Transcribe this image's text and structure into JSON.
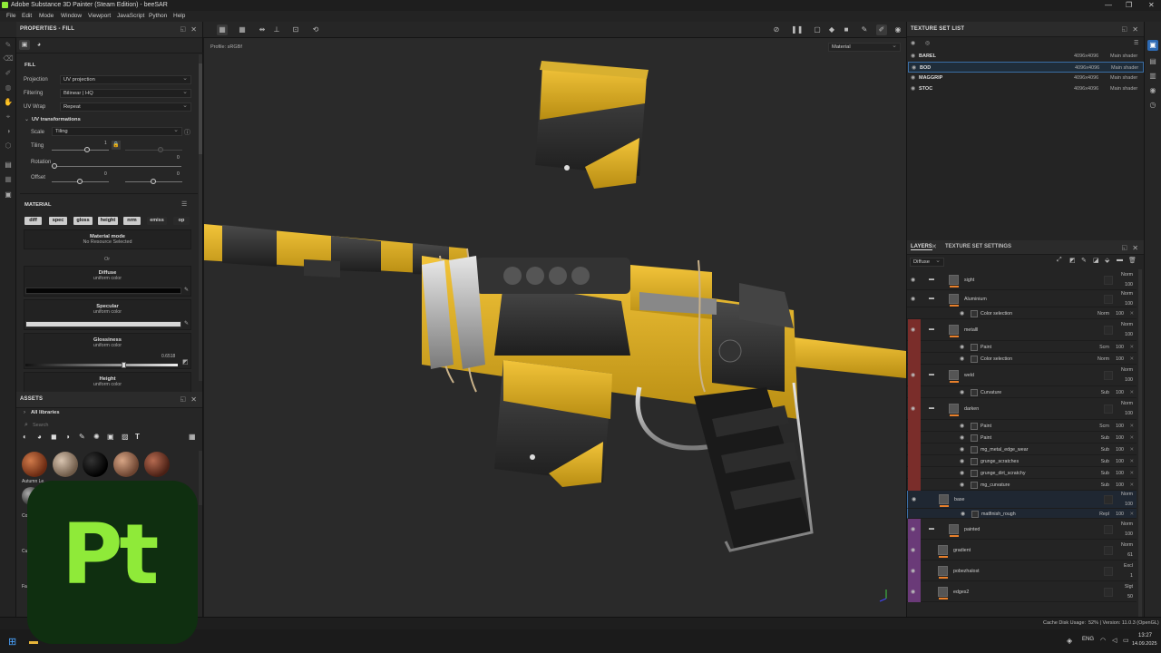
{
  "window": {
    "title": "Adobe Substance 3D Painter (Steam Edition) - beeSAR",
    "min": "—",
    "max": "❐",
    "close": "✕"
  },
  "menu": [
    "File",
    "Edit",
    "Mode",
    "Window",
    "Viewport",
    "JavaScript",
    "Python",
    "Help"
  ],
  "properties": {
    "title": "PROPERTIES - FILL",
    "section_fill": "FILL",
    "projection_label": "Projection",
    "projection_value": "UV projection",
    "filtering_label": "Filtering",
    "filtering_value": "Bilinear | HQ",
    "uvwrap_label": "UV Wrap",
    "uvwrap_value": "Repeat",
    "uvt_title": "UV transformations",
    "scale_label": "Scale",
    "scale_value": "Tiling",
    "tiling_label": "Tiling",
    "tiling_value": "1",
    "rotation_label": "Rotation",
    "rotation_value": "0",
    "offset_label": "Offset",
    "offset_x": "0",
    "offset_y": "0",
    "material_title": "MATERIAL",
    "channels": [
      "diff",
      "spec",
      "gloss",
      "height",
      "nrm",
      "emiss",
      "op"
    ],
    "material_mode": "Material mode",
    "no_resource": "No Resource Selected",
    "or": "Or",
    "diffuse": "Diffuse",
    "diffuse_sub": "uniform color",
    "specular": "Specular",
    "specular_sub": "uniform color",
    "glossiness": "Glossiness",
    "glossiness_sub": "uniform color",
    "glossiness_value": "0.6518",
    "height": "Height",
    "height_sub": "uniform color"
  },
  "assets": {
    "title": "ASSETS",
    "all_libraries": "All libraries",
    "search_placeholder": "Search",
    "items": [
      "Autumn Le...",
      "Co",
      "Cu",
      "Fa"
    ]
  },
  "viewport": {
    "profile": "Profile: sRGBf",
    "mode": "Material"
  },
  "texture_set_list": {
    "title": "TEXTURE SET LIST",
    "rows": [
      {
        "name": "BAREL",
        "res": "4096x4096",
        "shader": "Main shader"
      },
      {
        "name": "BOD",
        "res": "4096x4096",
        "shader": "Main shader"
      },
      {
        "name": "MAGGRIP",
        "res": "4096x4096",
        "shader": "Main shader"
      },
      {
        "name": "STOC",
        "res": "4096x4096",
        "shader": "Main shader"
      }
    ]
  },
  "layers": {
    "tab_layers": "LAYERS",
    "tab_tss": "TEXTURE SET SETTINGS",
    "channel": "Diffuse",
    "rows": [
      {
        "name": "sight",
        "blend": "Norm",
        "op": "100"
      },
      {
        "name": "Aluminium",
        "blend": "Norm",
        "op": "100"
      },
      {
        "name": "Color selection",
        "blend": "Norm",
        "op": "100"
      },
      {
        "name": "metalll",
        "blend": "Norm",
        "op": "100"
      },
      {
        "name": "Paint",
        "blend": "Scrn",
        "op": "100"
      },
      {
        "name": "Color selection",
        "blend": "Norm",
        "op": "100"
      },
      {
        "name": "weld",
        "blend": "Norm",
        "op": "100"
      },
      {
        "name": "Curvature",
        "blend": "Sub",
        "op": "100"
      },
      {
        "name": "darken",
        "blend": "Norm",
        "op": "100"
      },
      {
        "name": "Paint",
        "blend": "Scrn",
        "op": "100"
      },
      {
        "name": "Paint",
        "blend": "Sub",
        "op": "100"
      },
      {
        "name": "mg_metal_edge_wear",
        "blend": "Sub",
        "op": "100"
      },
      {
        "name": "grunge_scratches",
        "blend": "Sub",
        "op": "100"
      },
      {
        "name": "grunge_dirt_scratchy",
        "blend": "Sub",
        "op": "100"
      },
      {
        "name": "mg_curvature",
        "blend": "Sub",
        "op": "100"
      },
      {
        "name": "base",
        "blend": "Norm",
        "op": "100"
      },
      {
        "name": "matfinish_rough",
        "blend": "Repl",
        "op": "100"
      },
      {
        "name": "painted",
        "blend": "Norm",
        "op": "100"
      },
      {
        "name": "gradient",
        "blend": "Norm",
        "op": "61"
      },
      {
        "name": "pobezhalost",
        "blend": "Excl",
        "op": "1"
      },
      {
        "name": "edges2",
        "blend": "Slgt",
        "op": "50"
      }
    ]
  },
  "status": {
    "cache": "Cache Disk Usage:",
    "version": "52% | Version: 11.0.3 (OpenGL)"
  },
  "taskbar": {
    "lang": "ENG",
    "time": "13:27",
    "date": "14.09.2025"
  },
  "logo": "Pt"
}
